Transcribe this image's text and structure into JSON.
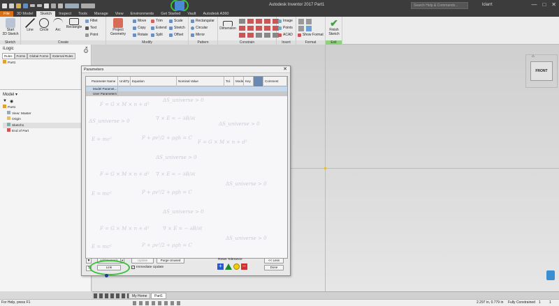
{
  "app_title": "Autodesk Inventor 2017  Part1",
  "search_placeholder": "Search Help & Commands...",
  "user": "lclarrt",
  "menu_tabs": [
    "File",
    "3D Model",
    "Sketch",
    "Inspect",
    "Tools",
    "Manage",
    "View",
    "Environments",
    "Get Started",
    "Vault",
    "Autodesk A360"
  ],
  "ribbon": {
    "start_sketch": "Start\n2D Sketch",
    "sketch_group": "Sketch",
    "line": "Line",
    "circle": "Circle",
    "arc": "Arc",
    "rectangle": "Rectangle",
    "fillet": "Fillet",
    "text": "Text",
    "point": "Point",
    "create_group": "Create",
    "project_geometry": "Project\nGeometry",
    "move": "Move",
    "copy": "Copy",
    "rotate": "Rotate",
    "trim": "Trim",
    "extend": "Extend",
    "split": "Split",
    "scale": "Scale",
    "stretch": "Stretch",
    "offset": "Offset",
    "modify_group": "Modify",
    "rect_pattern": "Rectangular",
    "circular": "Circular",
    "mirror": "Mirror",
    "pattern_group": "Pattern",
    "dimension": "Dimension",
    "constrain_group": "Constrain",
    "image": "Image",
    "points": "Points",
    "acad": "ACAD",
    "insert_group": "Insert",
    "show_format": "Show Format",
    "format_group": "Format",
    "finish_sketch": "Finish\nSketch",
    "exit_group": "Exit"
  },
  "ilogic": {
    "title": "iLogic",
    "tabs": [
      "Rules",
      "Forms",
      "Global Forms",
      "External Rules"
    ],
    "item": "Part1"
  },
  "model": {
    "title": "Model",
    "items": [
      "Part1",
      "View: Master",
      "Origin",
      "Sketch1",
      "End of Part"
    ]
  },
  "viewcube_label": "FRONT",
  "dialog": {
    "title": "Parameters",
    "columns": [
      "Parameter Name",
      "Unit/Ty",
      "Equation",
      "Nominal Value",
      "Tol.",
      "Model",
      "Key",
      "",
      "Comment"
    ],
    "rows": [
      "Model Paramet...",
      "User Parameters"
    ],
    "formulas": [
      "F = G × M × n + d²",
      "ΔS_universe > 0",
      "∇ × E = − ∂B/∂t",
      "E = mc²",
      "P + ρv²/2 + ρgh = C",
      "ΔS_universe > 0"
    ],
    "add_numeric": "Add Numeric",
    "update": "Update",
    "purge_unused": "Purge Unused",
    "link": "Link",
    "immediate_update": "Immediate Update",
    "reset_tolerance": "Reset Tolerance",
    "less": "<< Less",
    "done": "Done"
  },
  "doc_tabs": [
    "My Home",
    "Part1"
  ],
  "status": {
    "help": "For Help, press F1",
    "coords": "2.297 in, 0.779 in",
    "constraint": "Fully Constrained",
    "count1": "1",
    "count2": "1"
  },
  "colors": {
    "accent": "#d96f17",
    "highlight": "#38c038",
    "finish": "#3aa63a"
  }
}
